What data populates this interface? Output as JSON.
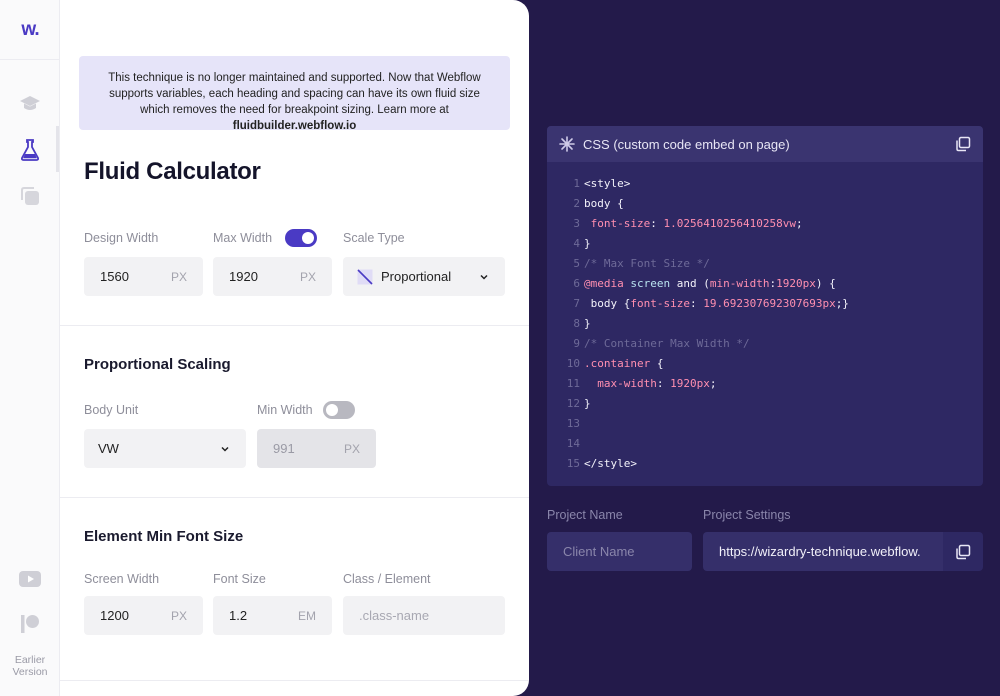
{
  "brand": {
    "logo_text": "w."
  },
  "rail": {
    "earlier_version": "Earlier\nVersion",
    "icons": [
      "graduation-cap-icon",
      "flask-icon",
      "copy-stack-icon",
      "youtube-icon",
      "patreon-icon"
    ]
  },
  "notice": {
    "text": "This technique is no longer maintained and supported. Now that Webflow supports variables, each heading and spacing can have its own fluid size which removes the need for breakpoint sizing. Learn more at ",
    "link": "fluidbuilder.webflow.io"
  },
  "calculator": {
    "title": "Fluid Calculator",
    "design_width": {
      "label": "Design Width",
      "value": "1560",
      "unit": "PX"
    },
    "max_width": {
      "label": "Max Width",
      "value": "1920",
      "unit": "PX",
      "enabled": true
    },
    "scale_type": {
      "label": "Scale Type",
      "value": "Proportional"
    }
  },
  "proportional": {
    "title": "Proportional Scaling",
    "body_unit": {
      "label": "Body Unit",
      "value": "VW"
    },
    "min_width": {
      "label": "Min Width",
      "value": "991",
      "unit": "PX",
      "enabled": false
    }
  },
  "element_min": {
    "title": "Element Min Font Size",
    "screen_width": {
      "label": "Screen Width",
      "value": "1200",
      "unit": "PX"
    },
    "font_size": {
      "label": "Font Size",
      "value": "1.2",
      "unit": "EM"
    },
    "class_element": {
      "label": "Class / Element",
      "placeholder": ".class-name"
    }
  },
  "code": {
    "title": "CSS (custom code embed on page)",
    "line_numbers": [
      "1",
      "2",
      "3",
      "4",
      "5",
      "6",
      "7",
      "8",
      "9",
      "10",
      "11",
      "12",
      "13",
      "14",
      "15"
    ],
    "l1": "<style>",
    "l2": "body {",
    "l3_prop": "font-size",
    "l3_val": "1.0256410256410258vw",
    "l4": "}",
    "l5": "/* Max Font Size */",
    "l6_kw": "@media",
    "l6_screen": "screen",
    "l6_and": "and (",
    "l6_prop": "min-width",
    "l6_val": "1920px",
    "l6_end": ") {",
    "l7_sel": "body {",
    "l7_prop": "font-size",
    "l7_val": "19.692307692307693px",
    "l7_end": ";}",
    "l8": "}",
    "l9": "/* Container Max Width */",
    "l10_sel": ".container",
    "l10_end": " {",
    "l11_prop": "max-width",
    "l11_val": "1920px",
    "l12": "}",
    "l15": "</style>"
  },
  "project": {
    "name_label": "Project Name",
    "name_placeholder": "Client Name",
    "settings_label": "Project Settings",
    "settings_value": "https://wizardry-technique.webflow."
  }
}
